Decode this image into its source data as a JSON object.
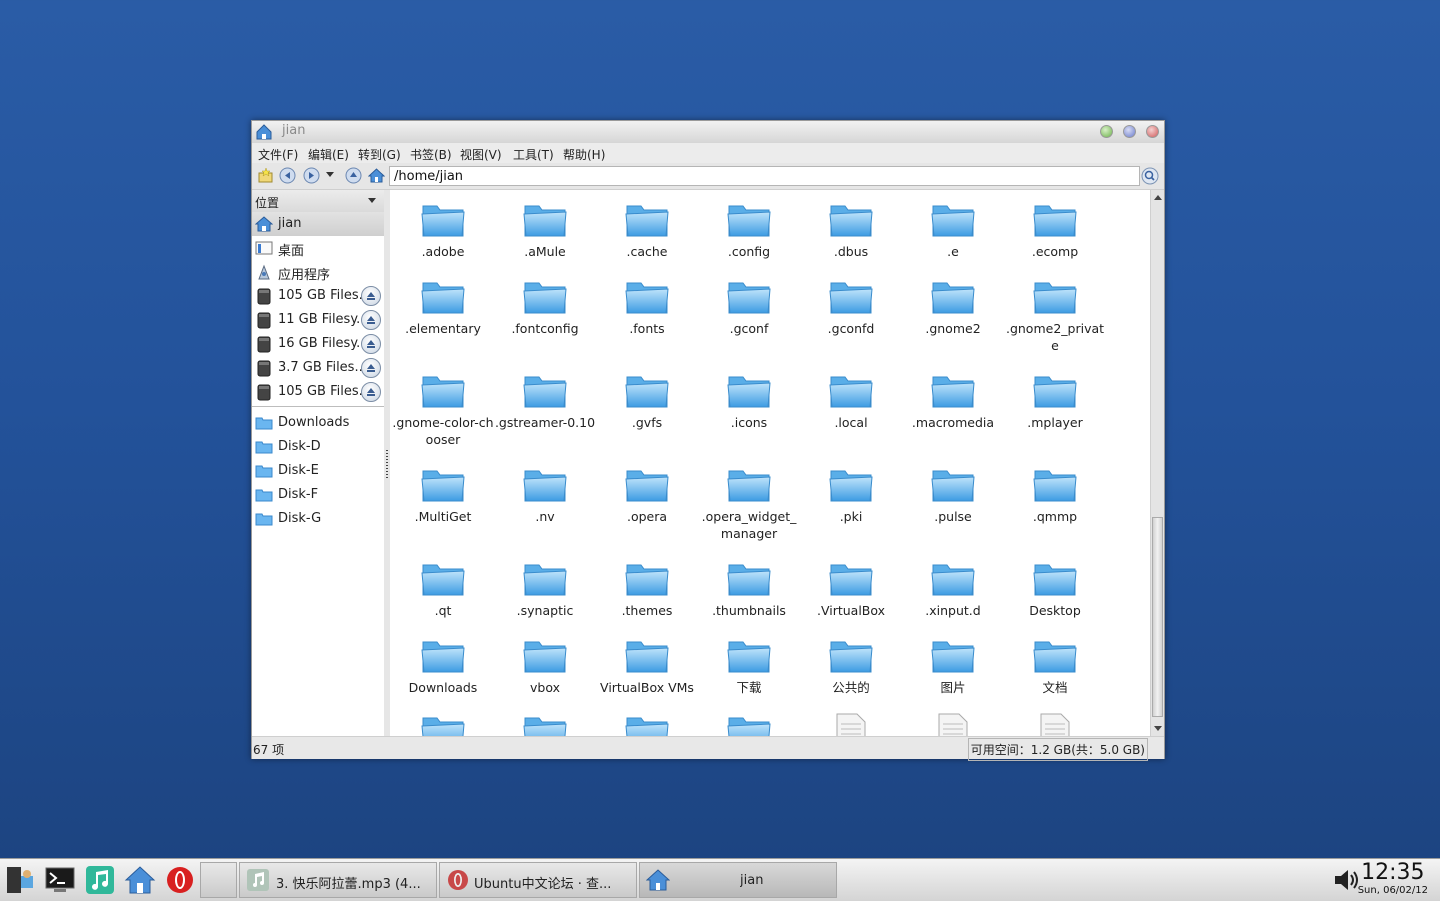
{
  "window": {
    "title": "jian",
    "menu": [
      "文件(F)",
      "编辑(E)",
      "转到(G)",
      "书签(B)",
      "视图(V)",
      "工具(T)",
      "帮助(H)"
    ],
    "address": "/home/jian"
  },
  "sidebar": {
    "header": "位置",
    "places": [
      {
        "label": "jian",
        "icon": "home-icon"
      },
      {
        "label": "桌面",
        "icon": "desktop-icon"
      },
      {
        "label": "应用程序",
        "icon": "applications-icon"
      }
    ],
    "drives": [
      {
        "label": "105 GB Files..."
      },
      {
        "label": "11 GB Filesy..."
      },
      {
        "label": "16 GB Filesy..."
      },
      {
        "label": "3.7 GB Files..."
      },
      {
        "label": "105 GB Files..."
      }
    ],
    "bookmarks": [
      "Downloads",
      "Disk-D",
      "Disk-E",
      "Disk-F",
      "Disk-G"
    ]
  },
  "files": [
    ".adobe",
    ".aMule",
    ".cache",
    ".config",
    ".dbus",
    ".e",
    ".ecomp",
    ".elementary",
    ".fontconfig",
    ".fonts",
    ".gconf",
    ".gconfd",
    ".gnome2",
    ".gnome2_private",
    ".gnome-color-chooser",
    ".gstreamer-0.10",
    ".gvfs",
    ".icons",
    ".local",
    ".macromedia",
    ".mplayer",
    ".MultiGet",
    ".nv",
    ".opera",
    ".opera_widget_manager",
    ".pki",
    ".pulse",
    ".qmmp",
    ".qt",
    ".synaptic",
    ".themes",
    ".thumbnails",
    ".VirtualBox",
    ".xinput.d",
    "Desktop",
    "Downloads",
    "vbox",
    "VirtualBox VMs",
    "下载",
    "公共的",
    "图片",
    "文档"
  ],
  "status": {
    "count": "67 项",
    "free": "可用空间：1.2 GB(共：5.0 GB)"
  },
  "taskbar": {
    "tasks": [
      {
        "label": "3. 快乐阿拉蕾.mp3 (4..."
      },
      {
        "label": "Ubuntu中文论坛 · 查..."
      },
      {
        "label": "jian"
      }
    ],
    "clock_time": "12:35",
    "clock_date": "Sun, 06/02/12"
  }
}
